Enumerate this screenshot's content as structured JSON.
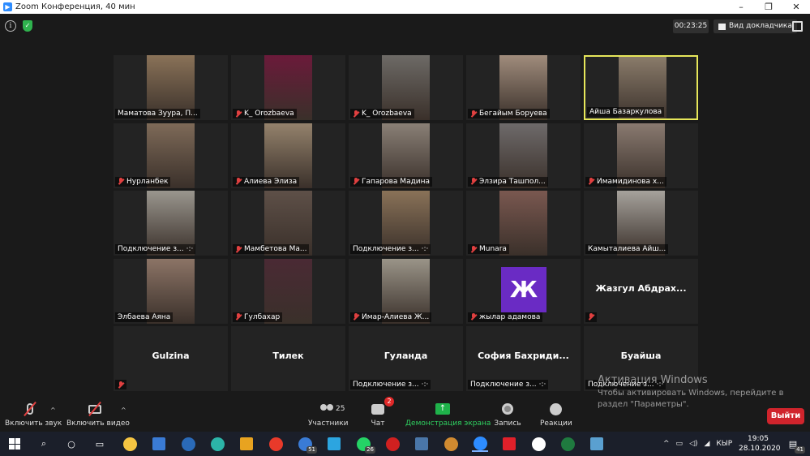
{
  "window": {
    "title": "Zoom Конференция, 40 мин",
    "controls": [
      "–",
      "❐",
      "✕"
    ]
  },
  "meeting": {
    "timer": "00:23:25",
    "view_button": "Вид докладчика"
  },
  "participants": [
    {
      "name": "Маматова Зуура, П...",
      "muted": false,
      "video": true,
      "color": "#8a7258"
    },
    {
      "name": "K_ Orozbaeva",
      "muted": true,
      "video": true,
      "color": "#6b1a3a"
    },
    {
      "name": "K_ Orozbaeva",
      "muted": true,
      "video": true,
      "color": "#6d6a66"
    },
    {
      "name": "Бегайым Боруева",
      "muted": true,
      "video": true,
      "color": "#a08c7c"
    },
    {
      "name": "Айша Базаркулова",
      "muted": false,
      "video": true,
      "active": true,
      "color": "#8a7b6a"
    },
    {
      "name": "Нурланбек",
      "muted": true,
      "video": true,
      "color": "#7e6a58"
    },
    {
      "name": "Алиева Элиза",
      "muted": true,
      "video": true,
      "color": "#94826c"
    },
    {
      "name": "Гапарова Мадина",
      "muted": true,
      "video": true,
      "color": "#8a8076"
    },
    {
      "name": "Элзира Ташпол...",
      "muted": true,
      "video": true,
      "color": "#6e6a6a"
    },
    {
      "name": "Имамидинова х...",
      "muted": true,
      "video": true,
      "color": "#8a7a70"
    },
    {
      "name": "Подключение з...",
      "muted": false,
      "video": true,
      "connecting": true,
      "color": "#9a968e"
    },
    {
      "name": "Мамбетова Ма...",
      "muted": true,
      "video": true,
      "color": "#5e5048"
    },
    {
      "name": "Подключение з...",
      "muted": false,
      "video": true,
      "connecting": true,
      "color": "#8a7258"
    },
    {
      "name": "Munara",
      "muted": true,
      "video": true,
      "color": "#7a5850"
    },
    {
      "name": "Камыталиева Айш...",
      "muted": false,
      "video": true,
      "color": "#a6a29c"
    },
    {
      "name": "Элбаева Аяна",
      "muted": false,
      "video": true,
      "color": "#8c7466"
    },
    {
      "name": "Гулбахар",
      "muted": true,
      "video": true,
      "color": "#4a2a34"
    },
    {
      "name": "Имар-Алиева Ж...",
      "muted": true,
      "video": true,
      "color": "#9a9488"
    },
    {
      "name": "жылар адамова",
      "muted": true,
      "video": false,
      "avatar": "Ж",
      "color": "#6a2bc4"
    },
    {
      "name": "",
      "center": "Жазгул  Абдрах...",
      "muted": true,
      "video": false
    },
    {
      "name": "",
      "center": "Gulzina",
      "muted": true,
      "video": false
    },
    {
      "name": "",
      "center": "Тилек",
      "muted": false,
      "video": false
    },
    {
      "name": "Подключение з...",
      "center": "Гуланда",
      "muted": false,
      "video": false,
      "connecting": true
    },
    {
      "name": "Подключение з...",
      "center": "София  Бахриди...",
      "muted": false,
      "video": false,
      "connecting": true
    },
    {
      "name": "Подключение з...",
      "center": "Буайша",
      "muted": false,
      "video": false,
      "connecting": true
    }
  ],
  "toolbar": {
    "unmute_label": "Включить звук",
    "video_label": "Включить видео",
    "participants_label": "Участники",
    "participants_count": "25",
    "chat_label": "Чат",
    "chat_badge": "2",
    "share_label": "Демонстрация экрана",
    "record_label": "Запись",
    "reactions_label": "Реакции",
    "leave_label": "Выйти"
  },
  "activation": {
    "title": "Активация Windows",
    "text": "Чтобы активировать Windows, перейдите в раздел \"Параметры\"."
  },
  "taskbar": {
    "apps": [
      {
        "name": "file-explorer-icon",
        "color": "#f5c542"
      },
      {
        "name": "store-icon",
        "color": "#3a7bd5"
      },
      {
        "name": "app-icon",
        "color": "#2a6ab8"
      },
      {
        "name": "edge-icon",
        "color": "#2cb5a8"
      },
      {
        "name": "chrome-icon",
        "color": "#e8a320"
      },
      {
        "name": "yandex-icon",
        "color": "#e83a2a"
      },
      {
        "name": "mail-icon",
        "color": "#3a7bd5",
        "badge": "51"
      },
      {
        "name": "telegram-icon",
        "color": "#2ca5e0"
      },
      {
        "name": "whatsapp-icon",
        "color": "#25d366",
        "badge": "26"
      },
      {
        "name": "record-app-icon",
        "color": "#d02020"
      },
      {
        "name": "vk-icon",
        "color": "#4a76a8"
      },
      {
        "name": "browser-icon",
        "color": "#d08a30"
      },
      {
        "name": "zoom-icon",
        "color": "#2d8cff",
        "active": true
      },
      {
        "name": "opera-icon",
        "color": "#e0202a"
      },
      {
        "name": "yandex-browser-icon",
        "color": "#ffffff"
      },
      {
        "name": "excel-icon",
        "color": "#1f7a3f"
      },
      {
        "name": "paint-icon",
        "color": "#5aa0d0"
      }
    ],
    "lang": "КЫР",
    "time": "19:05",
    "date": "28.10.2020",
    "notification_count": "41"
  }
}
